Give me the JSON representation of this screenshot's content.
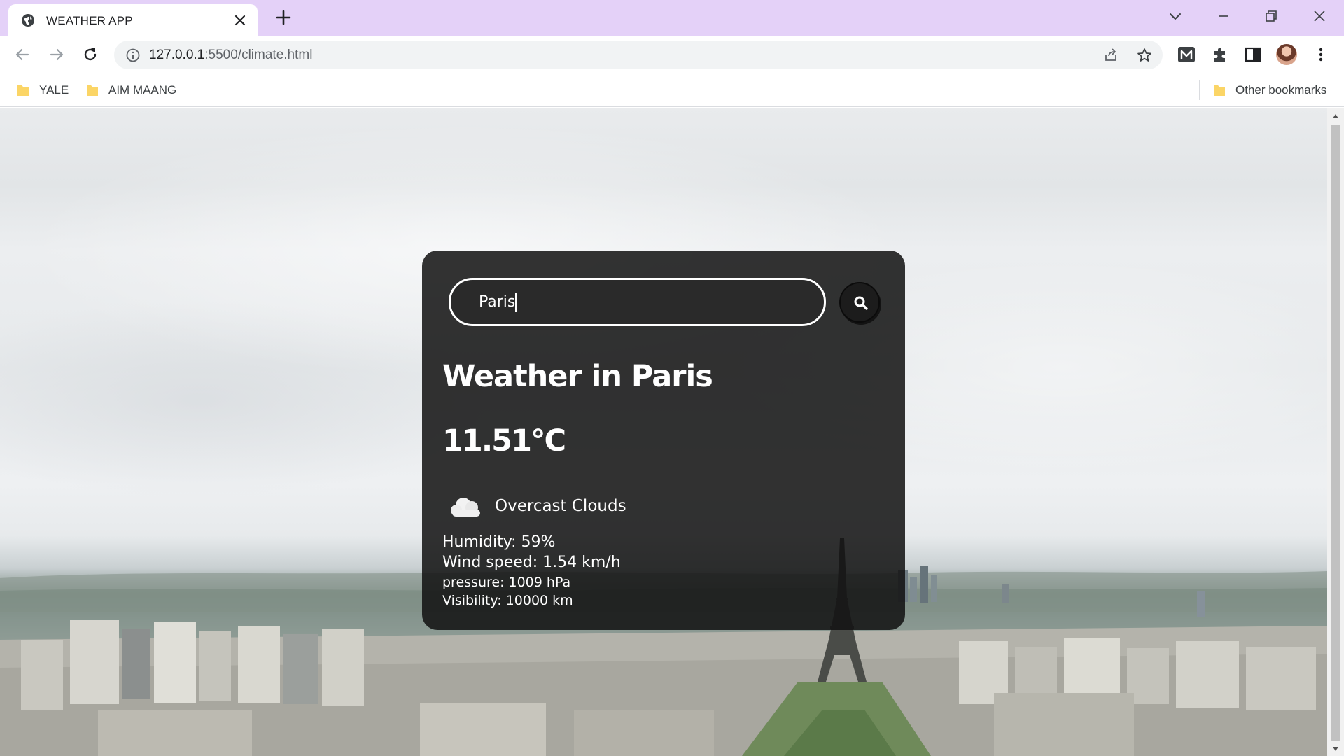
{
  "browser": {
    "tab_title": "WEATHER APP",
    "url_host": "127.0.0.1",
    "url_rest": ":5500/climate.html",
    "bookmarks": [
      "YALE",
      "AIM MAANG"
    ],
    "other_bookmarks": "Other bookmarks",
    "accent_color": "#e4d1f8"
  },
  "weather": {
    "search_value": "Paris",
    "title": "Weather in Paris",
    "temperature": "11.51°C",
    "condition": "Overcast Clouds",
    "condition_icon": "cloud-icon",
    "humidity": "Humidity: 59%",
    "wind": "Wind speed: 1.54 km/h",
    "pressure": "pressure: 1009 hPa",
    "visibility": "Visibility: 10000 km"
  }
}
